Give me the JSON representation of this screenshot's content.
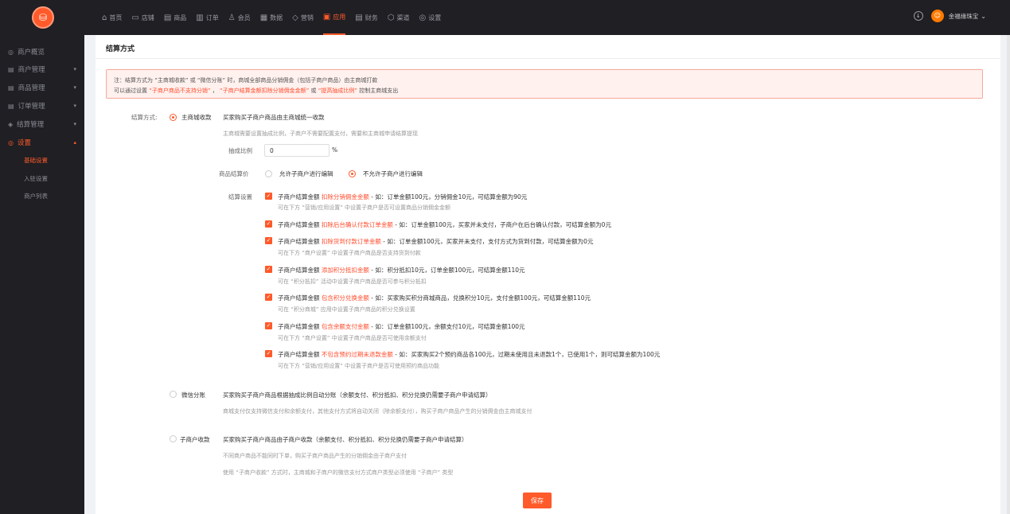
{
  "logo_icon": "coin-icon",
  "topnav": [
    {
      "icon": "⌂",
      "label": "首页",
      "name": "home"
    },
    {
      "icon": "▭",
      "label": "店铺",
      "name": "store"
    },
    {
      "icon": "▤",
      "label": "商品",
      "name": "goods"
    },
    {
      "icon": "▥",
      "label": "订单",
      "name": "orders"
    },
    {
      "icon": "♙",
      "label": "会员",
      "name": "members"
    },
    {
      "icon": "▦",
      "label": "数据",
      "name": "data"
    },
    {
      "icon": "◇",
      "label": "营销",
      "name": "marketing"
    },
    {
      "icon": "▣",
      "label": "应用",
      "name": "apps"
    },
    {
      "icon": "▤",
      "label": "财务",
      "name": "finance"
    },
    {
      "icon": "⬡",
      "label": "渠道",
      "name": "channels"
    },
    {
      "icon": "◎",
      "label": "设置",
      "name": "settings"
    }
  ],
  "user": {
    "name": "金福缘珠宝",
    "caret": "⌄"
  },
  "sidebar": {
    "items": [
      {
        "label": "商户概览",
        "icon": "◎"
      },
      {
        "label": "商户管理",
        "icon": "▤",
        "arrow": "▾"
      },
      {
        "label": "商品管理",
        "icon": "▤",
        "arrow": "▾"
      },
      {
        "label": "订单管理",
        "icon": "▤",
        "arrow": "▾"
      },
      {
        "label": "结算管理",
        "icon": "◈",
        "arrow": "▾"
      },
      {
        "label": "设置",
        "icon": "◎",
        "arrow": "▴"
      }
    ],
    "subitems": [
      "基础设置",
      "入驻设置",
      "商户列表"
    ]
  },
  "panel": {
    "title": "结算方式"
  },
  "notice": {
    "l1": "注：结算方式为 “主商城收款” 或 “微信分账” 时，商城全部商品分销佣金（包括子商户商品）由主商城打款",
    "l2a": "可以通过设置",
    "l2b": "“子商户商品不支持分销”",
    "l2c": "，",
    "l2d": "“子商户结算金额扣除分销佣金金额”",
    "l2e": "或",
    "l2f": "“提高抽成比例”",
    "l2g": "控制主商城支出"
  },
  "form": {
    "method_label": "结算方式:",
    "opt1": {
      "label": "主商城收款",
      "desc": "买家购买子商户商品由主商城统一收款",
      "hint": "主商城需要设置抽成比例，子商户不需要配置支付，需要和主商城申请结算提现"
    },
    "rate_label": "抽成比例",
    "rate_value": "0",
    "rate_unit": "%",
    "price_label": "商品结算价",
    "price_opt_a": "允许子商户进行编辑",
    "price_opt_b": "不允许子商户进行编辑",
    "settle_label": "结算设置",
    "rules": [
      {
        "p": "子商户结算金额",
        "r": "扣除分销佣金金额",
        "e": " - 如：订单金额100元，分销佣金10元，可结算金额为90元",
        "h": "可在下方 “营销/应用设置” 中设置子商户是否可设置商品分销佣金金额"
      },
      {
        "p": "子商户结算金额",
        "r": "扣除后台确认付款订单金额",
        "e": " - 如：订单金额100元，买家并未支付，子商户在后台确认付款，可结算金额为0元",
        "h": ""
      },
      {
        "p": "子商户结算金额",
        "r": "扣除货到付款订单金额",
        "e": " - 如：订单金额100元，买家并未支付，支付方式为货到付款，可结算金额为0元",
        "h": "可在下方 “商户设置” 中设置子商户商品是否支持货到付款"
      },
      {
        "p": "子商户结算金额",
        "r": "添加积分抵扣金额",
        "e": " - 如：积分抵扣10元，订单金额100元，可结算金额110元",
        "h": "可在 “积分抵扣” 活动中设置子商户商品是否可参与积分抵扣"
      },
      {
        "p": "子商户结算金额",
        "r": "包含积分兑换金额",
        "e": " - 如：买家购买积分商城商品，兑换积分10元，支付金额100元，可结算金额110元",
        "h": "可在 “积分商城” 应用中设置子商户商品的积分兑换设置"
      },
      {
        "p": "子商户结算金额",
        "r": "包含余额支付金额",
        "e": " - 如：订单金额100元，余额支付10元，可结算金额100元",
        "h": "可在下方 “商户设置” 中设置子商户商品是否可使用余额支付"
      },
      {
        "p": "子商户结算金额",
        "r": "不包含预约过期未退款金额",
        "e": " - 如：买家购买2个预约商品各100元，过期未使用且未退款1个，已使用1个，则可结算金额为100元",
        "h": "可在下方 “营销/应用设置” 中设置子商户是否可使用预约商品功能"
      }
    ],
    "opt2": {
      "label": "微信分账",
      "desc": "买家购买子商户商品根据抽成比例自动分账（余额支付、积分抵扣、积分兑换仍需要子商户申请结算）",
      "hint": "商城支付仅支持微信支付和余额支付，其他支付方式将自动关闭（除余额支付），购买子商户商品产生的分销佣金由主商城支付"
    },
    "opt3": {
      "label": "子商户收款",
      "desc": "买家购买子商户商品由子商户收款（余额支付、积分抵扣、积分兑换仍需要子商户申请结算）",
      "hint1": "不同商户商品不能同时下单，购买子商户商品产生的分销佣金由子商户支付",
      "hint2": "使用 “子商户收款” 方式时，主商城和子商户的微信支付方式商户类型必须使用 “子商户” 类型"
    }
  },
  "save_label": "保存"
}
